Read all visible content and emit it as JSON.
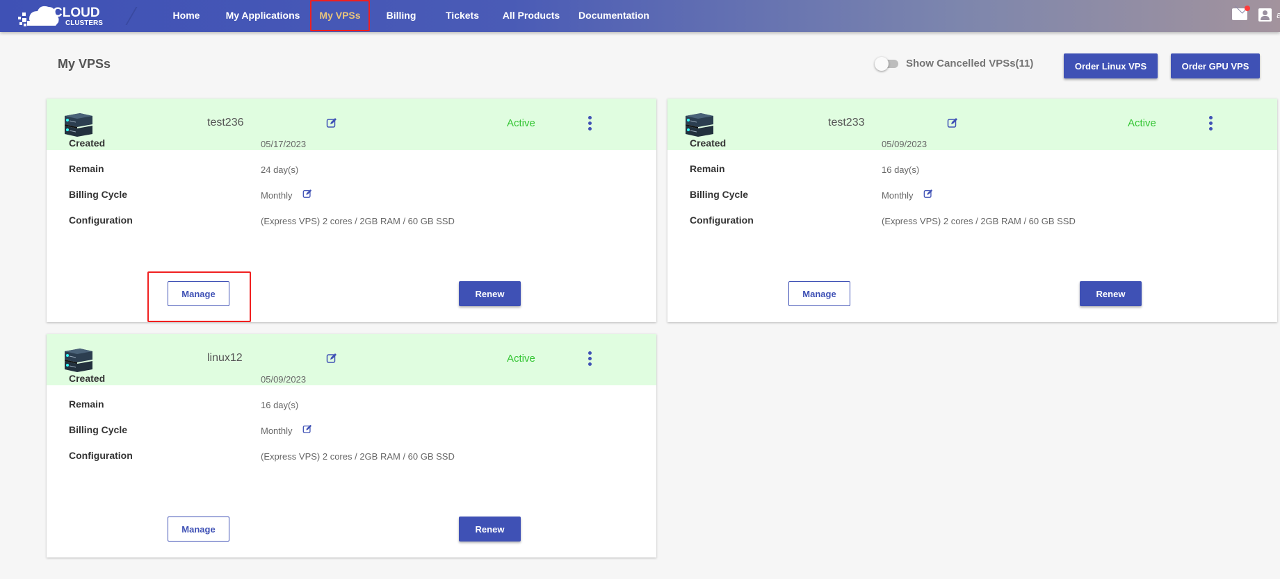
{
  "header": {
    "logo_main": "CLOUD",
    "logo_sub": "CLUSTERS",
    "nav": [
      {
        "label": "Home"
      },
      {
        "label": "My Applications"
      },
      {
        "label": "My VPSs",
        "active": true
      },
      {
        "label": "Billing"
      },
      {
        "label": "Tickets"
      },
      {
        "label": "All Products"
      },
      {
        "label": "Documentation"
      }
    ],
    "user_initial": "a",
    "mail_has_notification": true
  },
  "page": {
    "title": "My VPSs",
    "show_cancelled_label": "Show Cancelled VPSs(11)",
    "show_cancelled_on": false,
    "order_linux_label": "Order Linux VPS",
    "order_gpu_label": "Order GPU VPS"
  },
  "labels": {
    "created": "Created",
    "remain": "Remain",
    "billing_cycle": "Billing Cycle",
    "configuration": "Configuration",
    "manage": "Manage",
    "renew": "Renew"
  },
  "vps": [
    {
      "name": "test236",
      "status": "Active",
      "created": "05/17/2023",
      "remain": "24 day(s)",
      "billing_cycle": "Monthly",
      "configuration": "(Express VPS) 2 cores / 2GB RAM / 60 GB SSD"
    },
    {
      "name": "test233",
      "status": "Active",
      "created": "05/09/2023",
      "remain": "16 day(s)",
      "billing_cycle": "Monthly",
      "configuration": "(Express VPS) 2 cores / 2GB RAM / 60 GB SSD"
    },
    {
      "name": "linux12",
      "status": "Active",
      "created": "05/09/2023",
      "remain": "16 day(s)",
      "billing_cycle": "Monthly",
      "configuration": "(Express VPS) 2 cores / 2GB RAM / 60 GB SSD"
    }
  ],
  "colors": {
    "primary": "#3f51b5",
    "active_nav": "#e8c47c",
    "status_active": "#34c534",
    "card_header_bg": "#e0fde0",
    "highlight": "#f01f1f"
  }
}
